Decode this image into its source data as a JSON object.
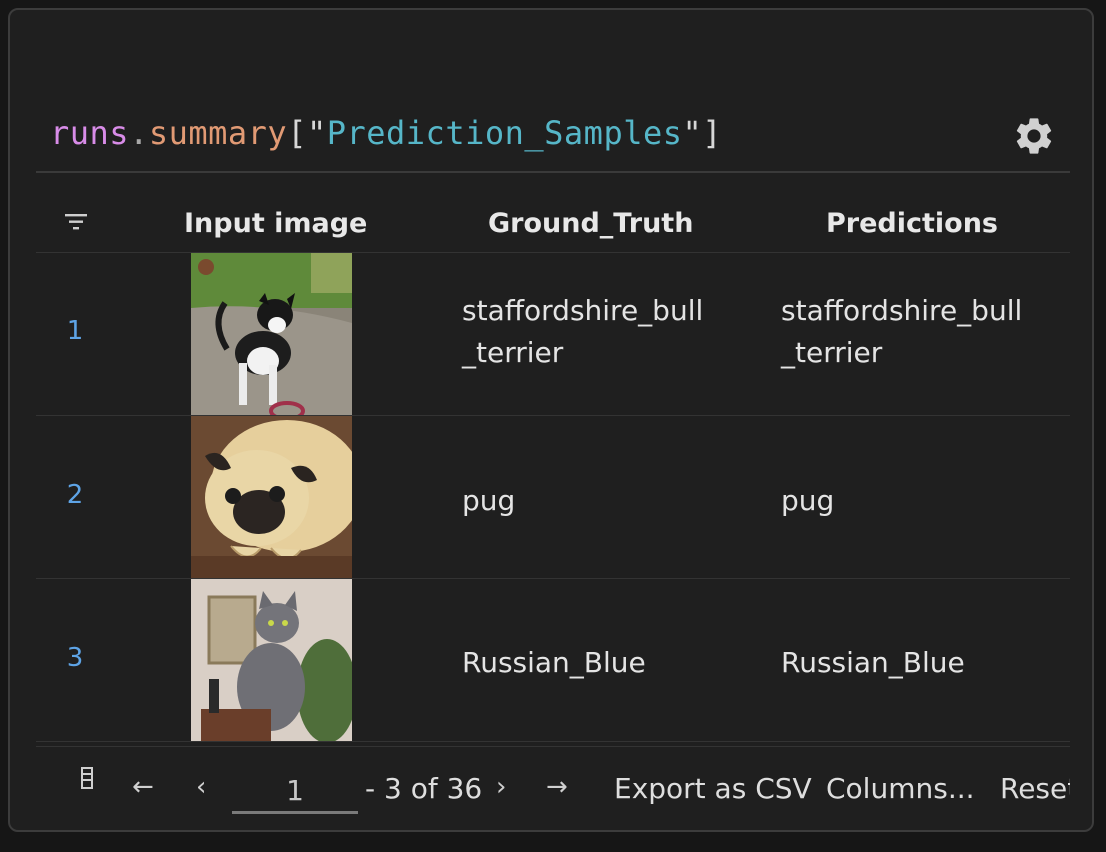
{
  "header": {
    "expr_runs": "runs",
    "expr_dot": ".",
    "expr_summary": "summary",
    "expr_open": "[\"",
    "expr_key": "Prediction_Samples",
    "expr_close": "\"]"
  },
  "settings_icon": "gear-icon",
  "table": {
    "columns": [
      "Input image",
      "Ground_Truth",
      "Predictions"
    ],
    "rows": [
      {
        "index": "1",
        "image": "dog photo",
        "ground_truth": "staffordshire_bull_terrier",
        "ground_truth_lines": [
          "staffordshire_bull",
          "_terrier"
        ],
        "prediction_lines": [
          "staffordshire_bull",
          "_terrier"
        ]
      },
      {
        "index": "2",
        "image": "pug photo",
        "ground_truth_lines": [
          "pug"
        ],
        "prediction_lines": [
          "pug"
        ]
      },
      {
        "index": "3",
        "image": "cat photo",
        "ground_truth_lines": [
          "Russian_Blue"
        ],
        "prediction_lines": [
          "Russian_Blue"
        ]
      }
    ]
  },
  "footer": {
    "page_value": "1",
    "range_text": "- 3 of 36",
    "export_label": "Export as CSV",
    "columns_label": "Columns...",
    "reset_label": "Reset"
  },
  "colors": {
    "accent_index": "#5ea4e6",
    "string_key": "#56b6c8",
    "runs_token": "#d88ce8",
    "summary_token": "#e19a74"
  }
}
